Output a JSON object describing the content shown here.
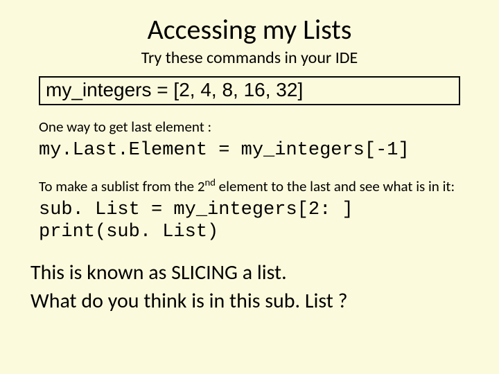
{
  "title": "Accessing my Lists",
  "subtitle": "Try these commands in your IDE",
  "box_code": "my_integers = [2, 4, 8, 16, 32]",
  "note1": "One way to get last element :",
  "code1": "my.Last.Element = my_integers[-1]",
  "note2_pre": "To make a sublist from the 2",
  "note2_sup": "nd",
  "note2_post": " element to the last and see what is in it:",
  "code2a": "sub. List = my_integers[2: ]",
  "code2b": "print(sub. List)",
  "closing1": "This is known as SLICING a list.",
  "closing2": "What do you think is in this sub. List ?"
}
